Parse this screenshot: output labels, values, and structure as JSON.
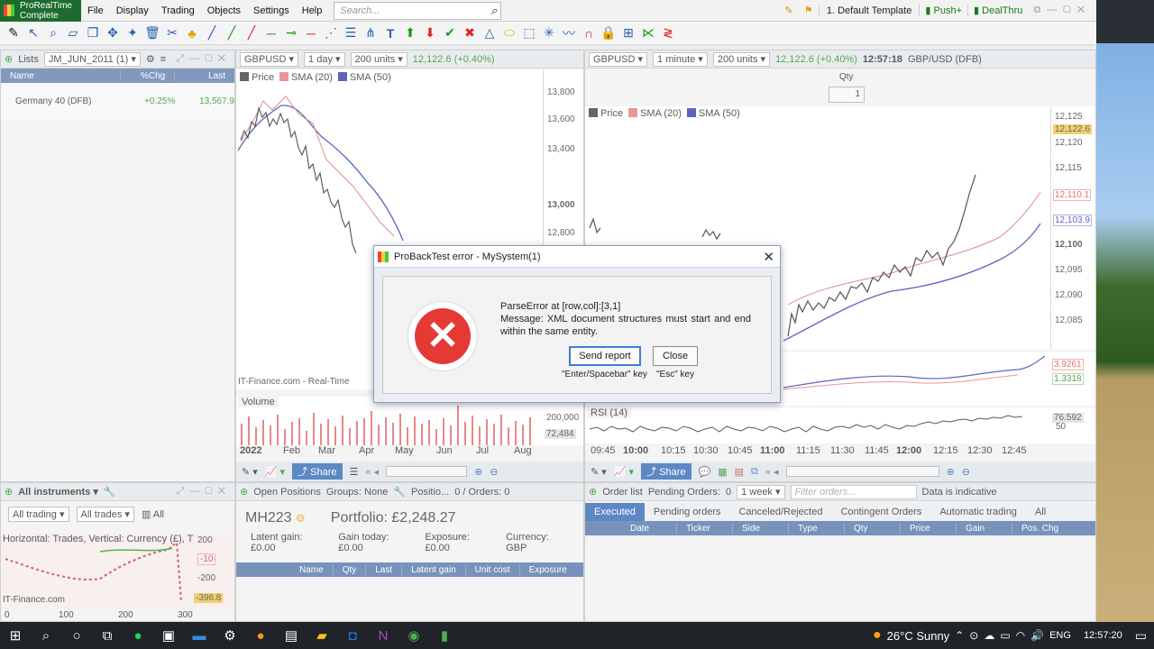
{
  "menubar": {
    "logo_line1": "ProRealTime",
    "logo_line2": "Complete",
    "items": [
      "File",
      "Display",
      "Trading",
      "Objects",
      "Settings",
      "Help"
    ],
    "search_placeholder": "Search...",
    "layout": "1. Default Template",
    "btn_push": "Push+",
    "btn_dealthru": "DealThru"
  },
  "lists": {
    "tab": "Lists",
    "list_name": "JM_JUN_2011 (1)",
    "cols": [
      "Name",
      "%Chg",
      "Last"
    ],
    "row": {
      "name": "Germany 40 (DFB)",
      "chg": "+0.25%",
      "last": "13,567.9"
    }
  },
  "chart_daily": {
    "symbol": "GBPUSD",
    "period": "1 day",
    "units": "200 units",
    "quote": "12,122.6 (+0.40%)",
    "legend": [
      "Price",
      "SMA (20)",
      "SMA (50)"
    ],
    "y_ticks": [
      "13,800",
      "13,600",
      "13,400",
      "13,000",
      "12,800"
    ],
    "footer": "IT-Finance.com - Real-Time",
    "volume_label": "Volume",
    "vol_tick": "200,000",
    "vol_last": "72,484",
    "x_labels": [
      "2022",
      "Feb",
      "Mar",
      "Apr",
      "May",
      "Jun",
      "Jul",
      "Aug"
    ],
    "share": "Share"
  },
  "chart_intraday": {
    "symbol": "GBPUSD",
    "period": "1 minute",
    "units": "200 units",
    "quote": "12,122.6 (+0.40%)",
    "time": "12:57:18",
    "instrument": "GBP/USD (DFB)",
    "qty_label": "Qty",
    "qty_value": "1",
    "legend": [
      "Price",
      "SMA (20)",
      "SMA (50)"
    ],
    "y_ticks": [
      "12,125",
      "12,120",
      "12,115",
      "12,110",
      "12,105",
      "12,100",
      "12,095",
      "12,090",
      "12,085"
    ],
    "price_tag": "12,122.6",
    "sma20_tag": "12,110.1",
    "sma50_tag": "12,103.9",
    "macd_tags": [
      "3.9261",
      "1.3318"
    ],
    "rsi_label": "RSI (14)",
    "rsi_tag": "76.592",
    "rsi_tick": "50",
    "x_labels": [
      "09:45",
      "10:00",
      "10:15",
      "10:30",
      "10:45",
      "11:00",
      "11:15",
      "11:30",
      "11:45",
      "12:00",
      "12:15",
      "12:30",
      "12:45"
    ],
    "share": "Share"
  },
  "instruments": {
    "title": "All instruments",
    "filter1": "All trading",
    "filter2": "All trades",
    "all": "All",
    "scatter_title": "Horizontal: Trades, Vertical: Currency (£), T",
    "y_ticks": [
      "200",
      "-10",
      "-200",
      "-396.8"
    ],
    "x_ticks": [
      "0",
      "100",
      "200",
      "300"
    ],
    "footer": "IT-Finance.com"
  },
  "positions": {
    "title": "Open Positions",
    "groups": "Groups: None",
    "positions": "Positio...",
    "orders": "0 / Orders: 0",
    "account": "MH223",
    "portfolio": "Portfolio: £2,248.27",
    "latent": "Latent gain: £0.00",
    "gain_today": "Gain today: £0.00",
    "exposure": "Exposure: £0.00",
    "currency": "Currency: GBP",
    "cols": [
      "Name",
      "Qty",
      "Last",
      "Latent gain",
      "Unit cost",
      "Exposure"
    ]
  },
  "orders": {
    "title": "Order list",
    "pending": "Pending Orders:",
    "pending_count": "0",
    "period": "1 week",
    "filter_placeholder": "Filter orders...",
    "indicative": "Data is indicative",
    "tabs": [
      "Executed",
      "Pending orders",
      "Canceled/Rejected",
      "Contingent Orders",
      "Automatic trading",
      "All"
    ],
    "cols": [
      "Date",
      "Ticker",
      "Side",
      "Type",
      "Qty",
      "Price",
      "Gain",
      "Pos. Chg"
    ]
  },
  "dialog": {
    "title": "ProBackTest error - MySystem(1)",
    "line1": "ParseError at [row,col]:[3,1]",
    "line2": "Message: XML document structures must start and end within the same entity.",
    "send": "Send report",
    "close": "Close",
    "hint_send": "\"Enter/Spacebar\" key",
    "hint_close": "\"Esc\" key"
  },
  "taskbar": {
    "weather": "26°C  Sunny",
    "lang": "ENG",
    "clock": "12:57:20"
  },
  "colors": {
    "accent": "#2860b0",
    "error": "#e53935",
    "sma20": "#e57373",
    "sma50": "#2b2fa8",
    "candle": "#1a1a1a"
  }
}
